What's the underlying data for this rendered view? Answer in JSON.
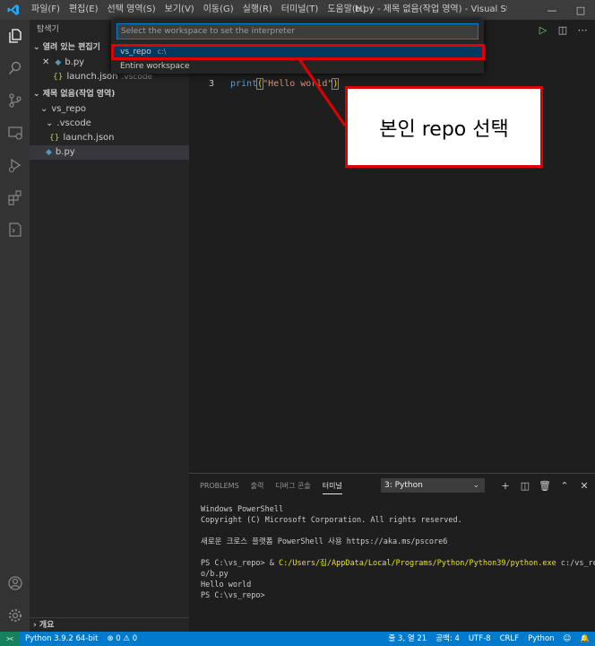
{
  "titlebar": {
    "menu": [
      "파일(F)",
      "편집(E)",
      "선택 영역(S)",
      "보기(V)",
      "이동(G)",
      "실행(R)",
      "터미널(T)",
      "도움말(H)"
    ],
    "title": "b.py - 제목 없음(작업 영역) - Visual Studio C..."
  },
  "sidebar": {
    "title": "탐색기",
    "open_editors_label": "열려 있는 편집기",
    "open_editors": [
      {
        "name": "b.py",
        "desc": ""
      },
      {
        "name": "launch.json",
        "desc": ".vscode"
      }
    ],
    "workspace_label": "제목 없음(작업 영역)",
    "tree": [
      "vs_repo",
      ".vscode",
      "launch.json",
      "b.py"
    ],
    "outline_label": "개요"
  },
  "quickpick": {
    "placeholder": "Select the workspace to set the interpreter",
    "items": [
      {
        "label": "vs_repo",
        "desc": "c:\\"
      },
      {
        "label": "Entire workspace",
        "desc": ""
      }
    ]
  },
  "editor": {
    "line_number": "3",
    "code_fn": "print",
    "code_open": "(",
    "code_str": "\"Hello world\"",
    "code_close": ")"
  },
  "annotation": {
    "text": "본인 repo 선택"
  },
  "panel": {
    "tabs": [
      "PROBLEMS",
      "출력",
      "디버그 콘솔",
      "터미널"
    ],
    "active_tab": 3,
    "terminal_select": "3: Python",
    "terminal_lines": [
      "Windows PowerShell",
      "Copyright (C) Microsoft Corporation. All rights reserved.",
      "",
      "새로운 크로스 플랫폼 PowerShell 사용 https://aka.ms/pscore6",
      "",
      "PS C:\\vs_repo> & ",
      "o/b.py",
      "Hello world",
      "PS C:\\vs_repo>"
    ],
    "command_path": "C:/Users/집/AppData/Local/Programs/Python/Python39/python.exe",
    "command_arg": " c:/vs_rep"
  },
  "statusbar": {
    "python": "Python 3.9.2 64-bit",
    "problems": "⊗ 0 ⚠ 0",
    "position": "줄 3, 열 21",
    "spaces": "공백: 4",
    "encoding": "UTF-8",
    "eol": "CRLF",
    "language": "Python"
  },
  "colors": {
    "accent": "#007acc",
    "highlight_red": "#e00000"
  }
}
